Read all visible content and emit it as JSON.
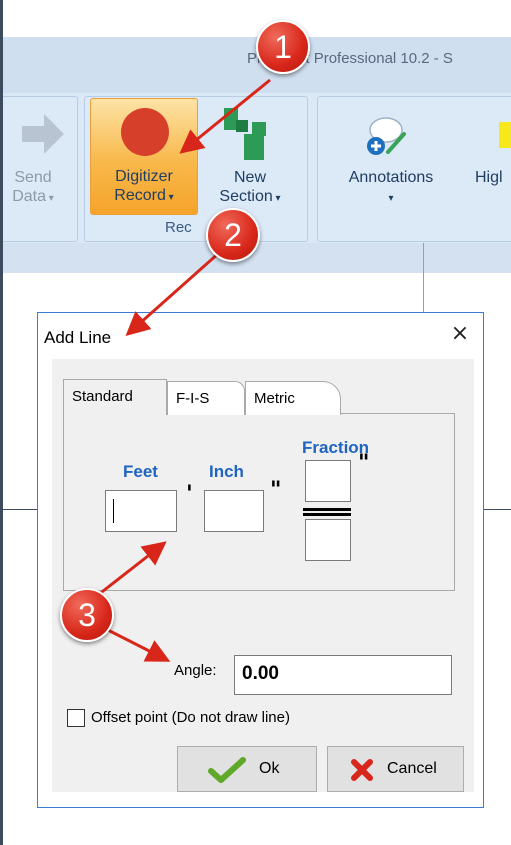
{
  "app": {
    "title": "PlanSwift Professional 10.2 - S"
  },
  "ribbon": {
    "send": {
      "line1": "Send",
      "line2": "Data"
    },
    "digitizer": {
      "line1": "Digitizer",
      "line2": "Record"
    },
    "new_section": {
      "line1": "New",
      "line2": "Section"
    },
    "group_record": "Rec",
    "annotations": "Annotations",
    "highlight": "Higl"
  },
  "dialog": {
    "title": "Add Line",
    "close": "×",
    "tabs": [
      "Standard",
      "F-I-S",
      "Metric"
    ],
    "labels": {
      "feet": "Feet",
      "inch": "Inch",
      "fraction": "Fraction"
    },
    "feet_value": "",
    "inch_value": "",
    "fraction_numerator": "",
    "fraction_denominator": "",
    "foot_mark": "'",
    "inch_mark": "\"",
    "angle_label": "Angle:",
    "angle_value": "0.00",
    "offset_checkbox": "Offset point (Do not draw line)",
    "ok": "Ok",
    "cancel": "Cancel"
  },
  "callouts": [
    "1",
    "2",
    "3"
  ],
  "colors": {
    "accent": "#1e64c0",
    "callout": "#d8271a",
    "ribbon": "#dbe8f6",
    "dialog_border": "#3c7ad8"
  }
}
